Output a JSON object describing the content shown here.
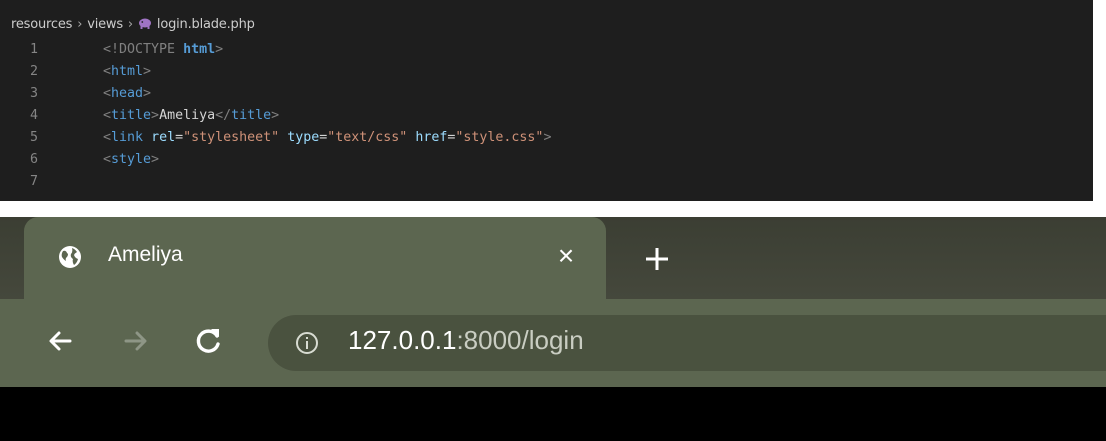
{
  "editor": {
    "breadcrumb": {
      "folder1": "resources",
      "folder2": "views",
      "file": "login.blade.php"
    },
    "lines": [
      {
        "num": "1",
        "parts": [
          [
            "punct",
            "<!DOCTYPE "
          ],
          [
            "kw",
            "html"
          ],
          [
            "punct",
            ">"
          ]
        ]
      },
      {
        "num": "2",
        "parts": [
          [
            "punct",
            "<"
          ],
          [
            "tag",
            "html"
          ],
          [
            "punct",
            ">"
          ]
        ]
      },
      {
        "num": "3",
        "parts": [
          [
            "punct",
            "<"
          ],
          [
            "tag",
            "head"
          ],
          [
            "punct",
            ">"
          ]
        ]
      },
      {
        "num": "4",
        "parts": [
          [
            "punct",
            "<"
          ],
          [
            "tag",
            "title"
          ],
          [
            "punct",
            ">"
          ],
          [
            "txt",
            "Ameliya"
          ],
          [
            "punct",
            "</"
          ],
          [
            "tag",
            "title"
          ],
          [
            "punct",
            ">"
          ]
        ]
      },
      {
        "num": "5",
        "parts": [
          [
            "punct",
            "<"
          ],
          [
            "tag",
            "link"
          ],
          [
            "txt",
            " "
          ],
          [
            "attr",
            "rel"
          ],
          [
            "eq",
            "="
          ],
          [
            "str",
            "\"stylesheet\""
          ],
          [
            "txt",
            " "
          ],
          [
            "attr",
            "type"
          ],
          [
            "eq",
            "="
          ],
          [
            "str",
            "\"text/css\""
          ],
          [
            "txt",
            " "
          ],
          [
            "attr",
            "href"
          ],
          [
            "eq",
            "="
          ],
          [
            "str",
            "\"style.css\""
          ],
          [
            "punct",
            ">"
          ]
        ]
      },
      {
        "num": "6",
        "parts": [
          [
            "punct",
            "<"
          ],
          [
            "tag",
            "style"
          ],
          [
            "punct",
            ">"
          ]
        ]
      },
      {
        "num": "7",
        "parts": [
          [
            "txt",
            "  "
          ]
        ]
      }
    ]
  },
  "browser": {
    "tab": {
      "title": "Ameliya",
      "close_glyph": "×"
    },
    "new_tab_glyph": "+",
    "url": {
      "host": "127.0.0.1",
      "rest": ":8000/login"
    }
  },
  "colors": {
    "editor_bg": "#1e1e1e",
    "tag": "#569cd6",
    "attr": "#9cdcfe",
    "string": "#ce9178",
    "tab_active": "#5c6650",
    "tabstrip": "#3f4236"
  },
  "icons": {
    "favicon": "globe-icon",
    "back": "back-arrow-icon",
    "forward": "forward-arrow-icon",
    "reload": "reload-icon",
    "info": "info-icon",
    "close": "close-icon",
    "new_tab": "plus-icon",
    "breadcrumb_sep": "chevron-right-icon",
    "file": "php-elephant-icon"
  }
}
